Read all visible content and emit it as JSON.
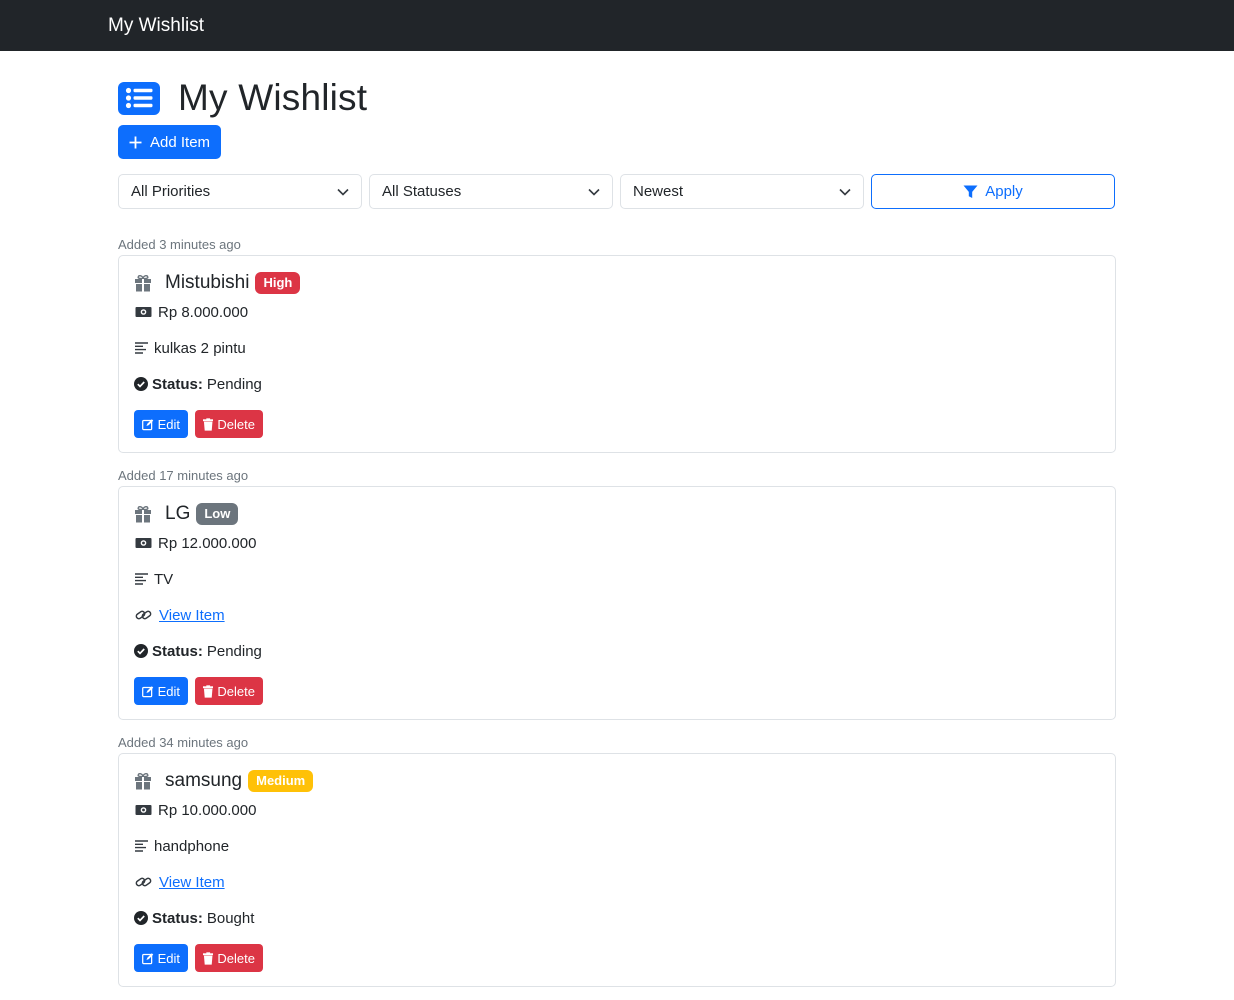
{
  "navbar": {
    "brand": "My Wishlist"
  },
  "page": {
    "title": "My Wishlist",
    "add_label": "Add Item"
  },
  "filters": {
    "priority": "All Priorities",
    "status": "All Statuses",
    "sort": "Newest",
    "apply_label": "Apply"
  },
  "labels": {
    "status": "Status:",
    "edit": "Edit",
    "delete": "Delete",
    "view_item": "View Item"
  },
  "items": [
    {
      "added": "Added 3 minutes ago",
      "name": "Mistubishi",
      "priority": "High",
      "price": "Rp 8.000.000",
      "description": "kulkas 2 pintu",
      "status": "Pending"
    },
    {
      "added": "Added 17 minutes ago",
      "name": "LG",
      "priority": "Low",
      "price": "Rp 12.000.000",
      "description": "TV",
      "status": "Pending"
    },
    {
      "added": "Added 34 minutes ago",
      "name": "samsung",
      "priority": "Medium",
      "price": "Rp 10.000.000",
      "description": "handphone",
      "status": "Bought"
    }
  ],
  "colors": {
    "primary": "#0d6efd",
    "danger": "#dc3545",
    "secondary": "#6c757d",
    "warning": "#ffc107",
    "navbar": "#212529"
  }
}
